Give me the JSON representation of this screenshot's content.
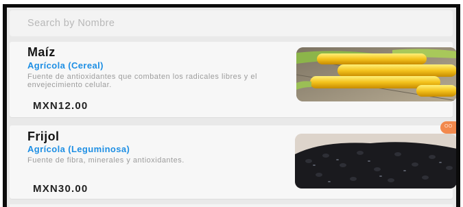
{
  "search": {
    "placeholder": "Search by Nombre"
  },
  "products": [
    {
      "name": "Maíz",
      "category": "Agrícola (Cereal)",
      "description": "Fuente de antioxidantes que combaten los radicales libres y el envejecimiento celular.",
      "price": "MXN12.00",
      "image": "corn-photo"
    },
    {
      "name": "Frijol",
      "category": "Agrícola (Leguminosa)",
      "description": "Fuente de fibra, minerales y antioxidantes.",
      "price": "MXN30.00",
      "image": "black-beans-photo",
      "badge": "OO"
    }
  ],
  "colors": {
    "accent": "#1e8fe4",
    "badge": "#f2894d",
    "background": "#e9e9e9"
  }
}
